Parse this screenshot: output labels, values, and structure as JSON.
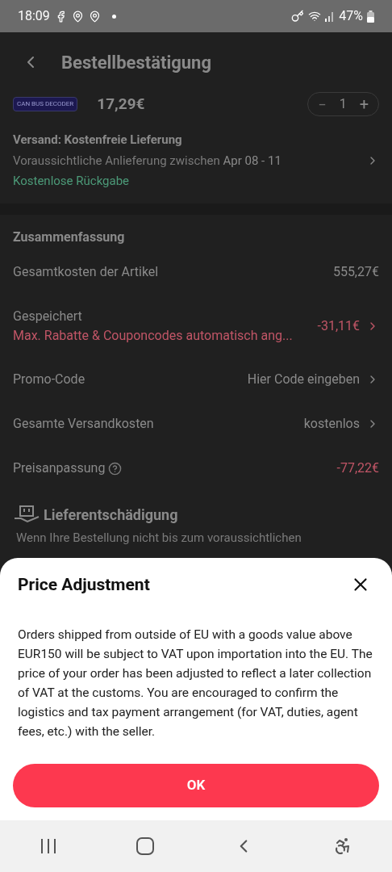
{
  "status_bar": {
    "time": "18:09",
    "battery": "47%"
  },
  "header": {
    "title": "Bestellbestätigung"
  },
  "product": {
    "badge": "CAN BUS DECODER",
    "price": "17,29€",
    "quantity": "1",
    "minus": "−",
    "plus": "+"
  },
  "shipping": {
    "title": "Versand: Kostenfreie Lieferung",
    "delivery_prefix": "Voraussichtliche Anlieferung zwischen",
    "delivery_dates": "Apr 08 - 11",
    "returns": "Kostenlose Rückgabe"
  },
  "summary": {
    "title": "Zusammenfassung",
    "rows": [
      {
        "kind": "plain",
        "label": "Gesamtkosten der Artikel",
        "value": "555,27€"
      },
      {
        "kind": "saved",
        "label": "Gespeichert",
        "note": "Max. Rabatte & Couponcodes automatisch ang...",
        "value": "-31,11€"
      },
      {
        "kind": "link",
        "label": "Promo-Code",
        "value": "Hier Code eingeben"
      },
      {
        "kind": "link",
        "label": "Gesamte Versandkosten",
        "value": "kostenlos"
      },
      {
        "kind": "help",
        "label": "Preisanpassung",
        "value": "-77,22€"
      }
    ]
  },
  "compensation": {
    "title": "Lieferentschädigung",
    "text": "Wenn Ihre Bestellung nicht bis zum voraussichtlichen"
  },
  "sheet": {
    "title": "Price Adjustment",
    "body": "Orders shipped from outside of EU with a goods value above EUR150 will be subject to VAT upon importation into the EU. The price of your order has been adjusted to reflect a later collection of VAT at the customs. You are encouraged to confirm the logistics and tax payment arrangement (for VAT, duties, agent fees, etc.) with the seller.",
    "button": "OK"
  }
}
